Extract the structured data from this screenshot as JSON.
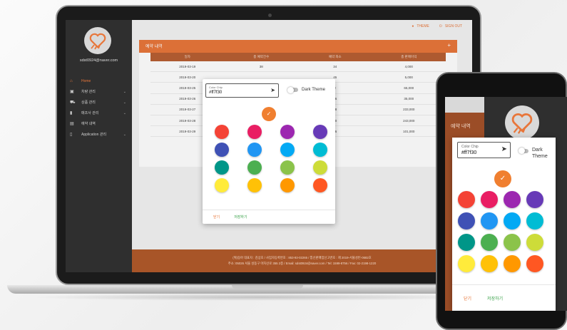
{
  "app": {
    "user_email": "sdst0924@naver.com",
    "top_links": {
      "theme": "THEME",
      "signout": "SIGN OUT"
    }
  },
  "sidebar": {
    "items": [
      {
        "label": "Home",
        "icon": "home-icon",
        "glyph": "⌂",
        "active": true,
        "expandable": false
      },
      {
        "label": "차량 관리",
        "icon": "car-icon",
        "glyph": "▣",
        "active": false,
        "expandable": true
      },
      {
        "label": "상품 관리",
        "icon": "cart-icon",
        "glyph": "⛟",
        "active": false,
        "expandable": true
      },
      {
        "label": "매조사 관리",
        "icon": "chart-icon",
        "glyph": "▮",
        "active": false,
        "expandable": true
      },
      {
        "label": "예약 내역",
        "icon": "calendar-icon",
        "glyph": "▤",
        "active": false,
        "expandable": false
      },
      {
        "label": "Application 관리",
        "icon": "phone-icon",
        "glyph": "▯",
        "active": false,
        "expandable": true
      }
    ]
  },
  "panel": {
    "title": "예약 내역",
    "columns": [
      "일자",
      "총 예약건수",
      "예약 좌소",
      "총 판매이익"
    ],
    "rows": [
      [
        "2019-03-19",
        "38",
        "34",
        "4,000"
      ],
      [
        "2019-03-20",
        "",
        "45",
        "5,000"
      ],
      [
        "2019-03-25",
        "",
        "2",
        "65,000"
      ],
      [
        "2019-03-26",
        "",
        "26",
        "35,000"
      ],
      [
        "2019-03-27",
        "",
        "28",
        "233,000"
      ],
      [
        "2019-03-28",
        "",
        "30",
        "243,000"
      ],
      [
        "2019-03-29",
        "",
        "46",
        "101,000"
      ]
    ]
  },
  "footer": {
    "line1": "(위)동아 대표자 : 김상호 / 사업자등록번호 : 853-93-02265 / 통신판매업신고번호 : 제 2019-서울성빈-0682호",
    "line2": "주소: 05026 서울 성동구 아차산로 355 2층 / Email: sdst0924@naver.com / Tel: 1599-8756 / Fax: 02-2198-1220"
  },
  "dialog": {
    "field_label": "Color Chip",
    "field_value": "#ff7f30",
    "toggle_label": "Dark Theme",
    "selected_color": "#f07f30",
    "close_label": "닫기",
    "save_label": "저장하기",
    "colors": [
      "#f44336",
      "#e91e63",
      "#9c27b0",
      "#673ab7",
      "#3f51b5",
      "#2196f3",
      "#03a9f4",
      "#00bcd4",
      "#009688",
      "#4caf50",
      "#8bc34a",
      "#cddc39",
      "#ffeb3b",
      "#ffc107",
      "#ff9800",
      "#ff5722"
    ]
  },
  "phone": {
    "side_text": "예약 내역",
    "field_label": "Color Chip",
    "field_value": "#ff7f30",
    "toggle_label": "Dark Theme",
    "close_label": "닫기",
    "save_label": "저장하기"
  }
}
